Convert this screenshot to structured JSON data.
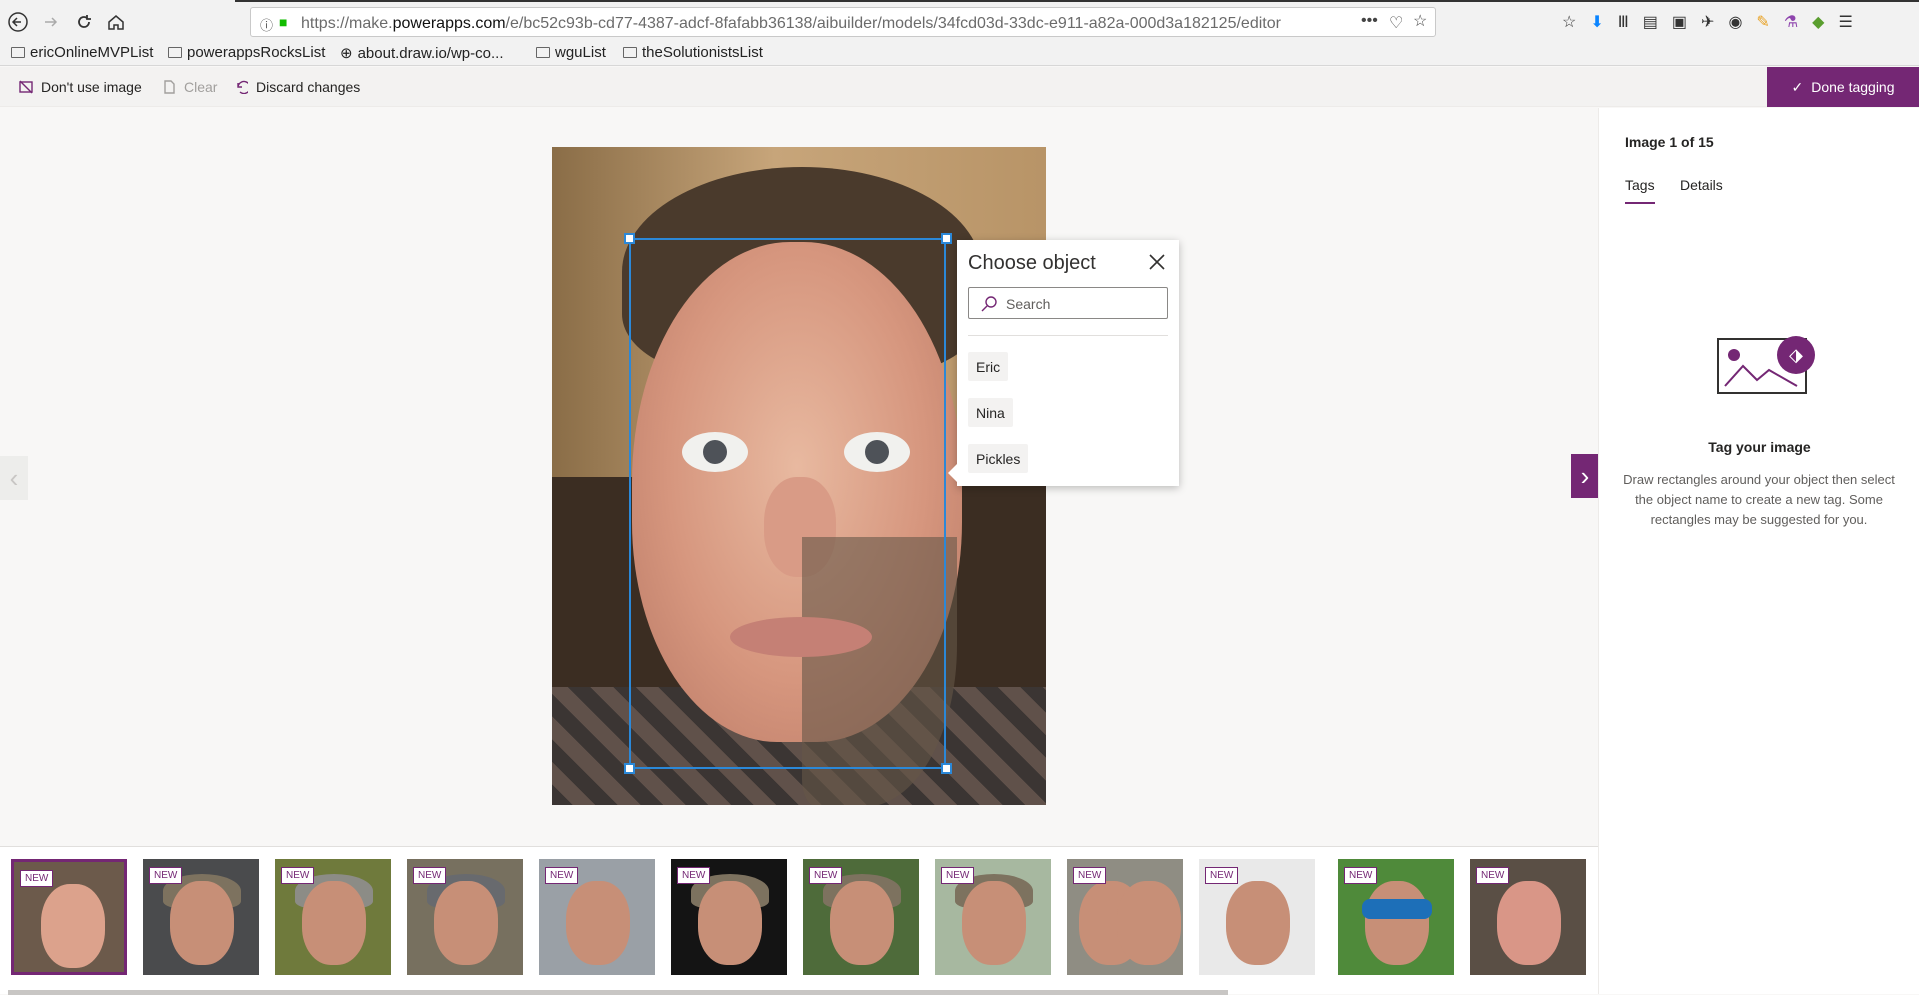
{
  "browser": {
    "url_prefix": "https://make.",
    "url_host": "powerapps.com",
    "url_path": "/e/bc52c93b-cd77-4387-adcf-8fafabb36138/aibuilder/models/34fcd03d-33dc-e911-a82a-000d3a182125/editor",
    "bookmarks": [
      "ericOnlineMVPList",
      "powerappsRocksList",
      "about.draw.io/wp-co...",
      "wguList",
      "theSolutionistsList"
    ]
  },
  "toolbar": {
    "dont_use": "Don't use image",
    "clear": "Clear",
    "discard": "Discard changes",
    "done": "Done tagging"
  },
  "popup": {
    "title": "Choose object",
    "search_placeholder": "Search",
    "options": [
      "Eric",
      "Nina",
      "Pickles"
    ]
  },
  "side": {
    "image_count": "Image 1 of 15",
    "tabs": [
      "Tags",
      "Details"
    ],
    "empty_title": "Tag your image",
    "empty_desc": "Draw rectangles around your object then select the object name to create a new tag. Some rectangles may be suggested for you."
  },
  "thumbnails": {
    "badge": "NEW",
    "count": 12
  },
  "colors": {
    "accent": "#742774",
    "selection": "#2b88d8"
  }
}
